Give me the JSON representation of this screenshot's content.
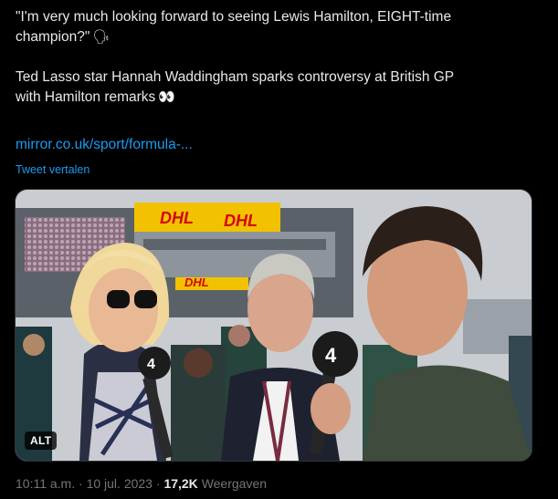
{
  "tweet": {
    "line1": "\"I'm very much looking forward to seeing Lewis Hamilton, EIGHT-time",
    "line2": "champion?\"",
    "line2_emoji": "🗣",
    "line3": "Ted Lasso star Hannah Waddingham sparks controversy at British GP",
    "line4": "with Hamilton remarks",
    "line4_emoji": "👀",
    "link": "mirror.co.uk/sport/formula-...",
    "translate": "Tweet vertalen"
  },
  "media": {
    "alt_badge": "ALT",
    "banner_text_1": "DHL",
    "banner_text_2": "DHL",
    "banner_text_3": "DHL",
    "mic_icon": "channel-4-logo"
  },
  "meta": {
    "time": "10:11 a.m.",
    "separator": "·",
    "date": "10 jul. 2023",
    "views_count": "17,2K",
    "views_label": "Weergaven"
  }
}
